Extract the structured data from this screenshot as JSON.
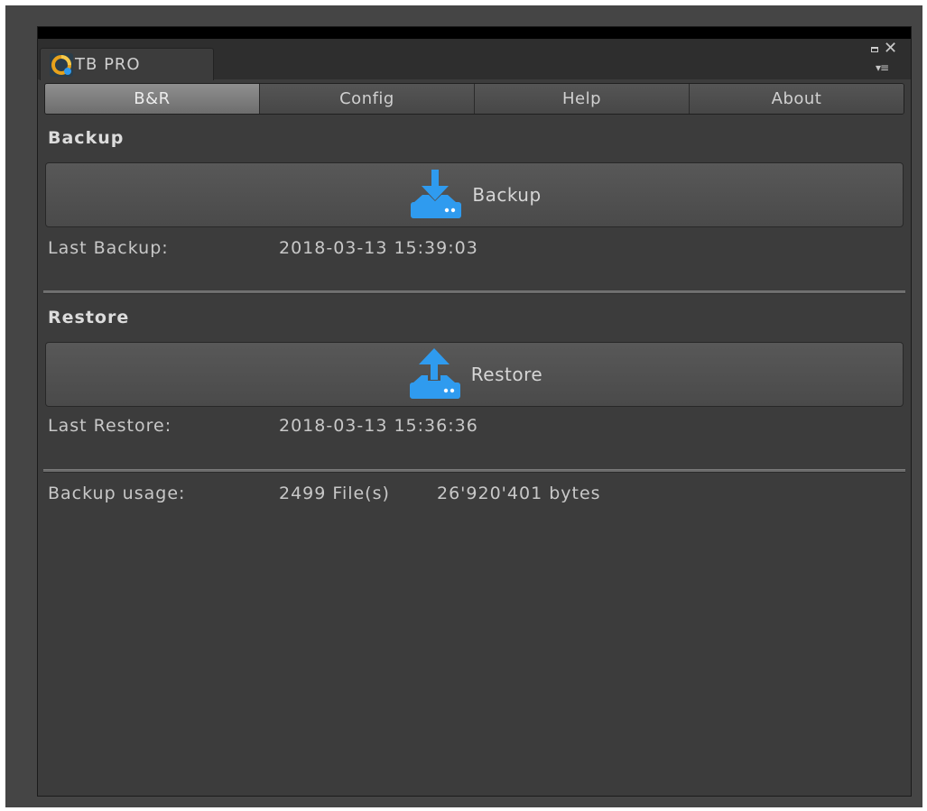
{
  "window": {
    "tab_title": "TB PRO",
    "icons": {
      "app": "tb-pro-logo-icon",
      "maximize": "maximize-icon",
      "close": "close-icon",
      "menu": "window-menu-icon"
    }
  },
  "tabs": [
    {
      "label": "B&R",
      "active": true
    },
    {
      "label": "Config",
      "active": false
    },
    {
      "label": "Help",
      "active": false
    },
    {
      "label": "About",
      "active": false
    }
  ],
  "backup": {
    "section_title": "Backup",
    "button_label": "Backup",
    "icon": "download-icon",
    "last_label": "Last Backup:",
    "last_value": "2018-03-13 15:39:03"
  },
  "restore": {
    "section_title": "Restore",
    "button_label": "Restore",
    "icon": "upload-icon",
    "last_label": "Last Restore:",
    "last_value": "2018-03-13 15:36:36"
  },
  "usage": {
    "label": "Backup usage:",
    "files": "2499 File(s)",
    "bytes": "26'920'401 bytes"
  },
  "colors": {
    "accent_blue": "#2f9bef",
    "panel_bg": "#3c3c3c",
    "active_tab": "#808080"
  }
}
